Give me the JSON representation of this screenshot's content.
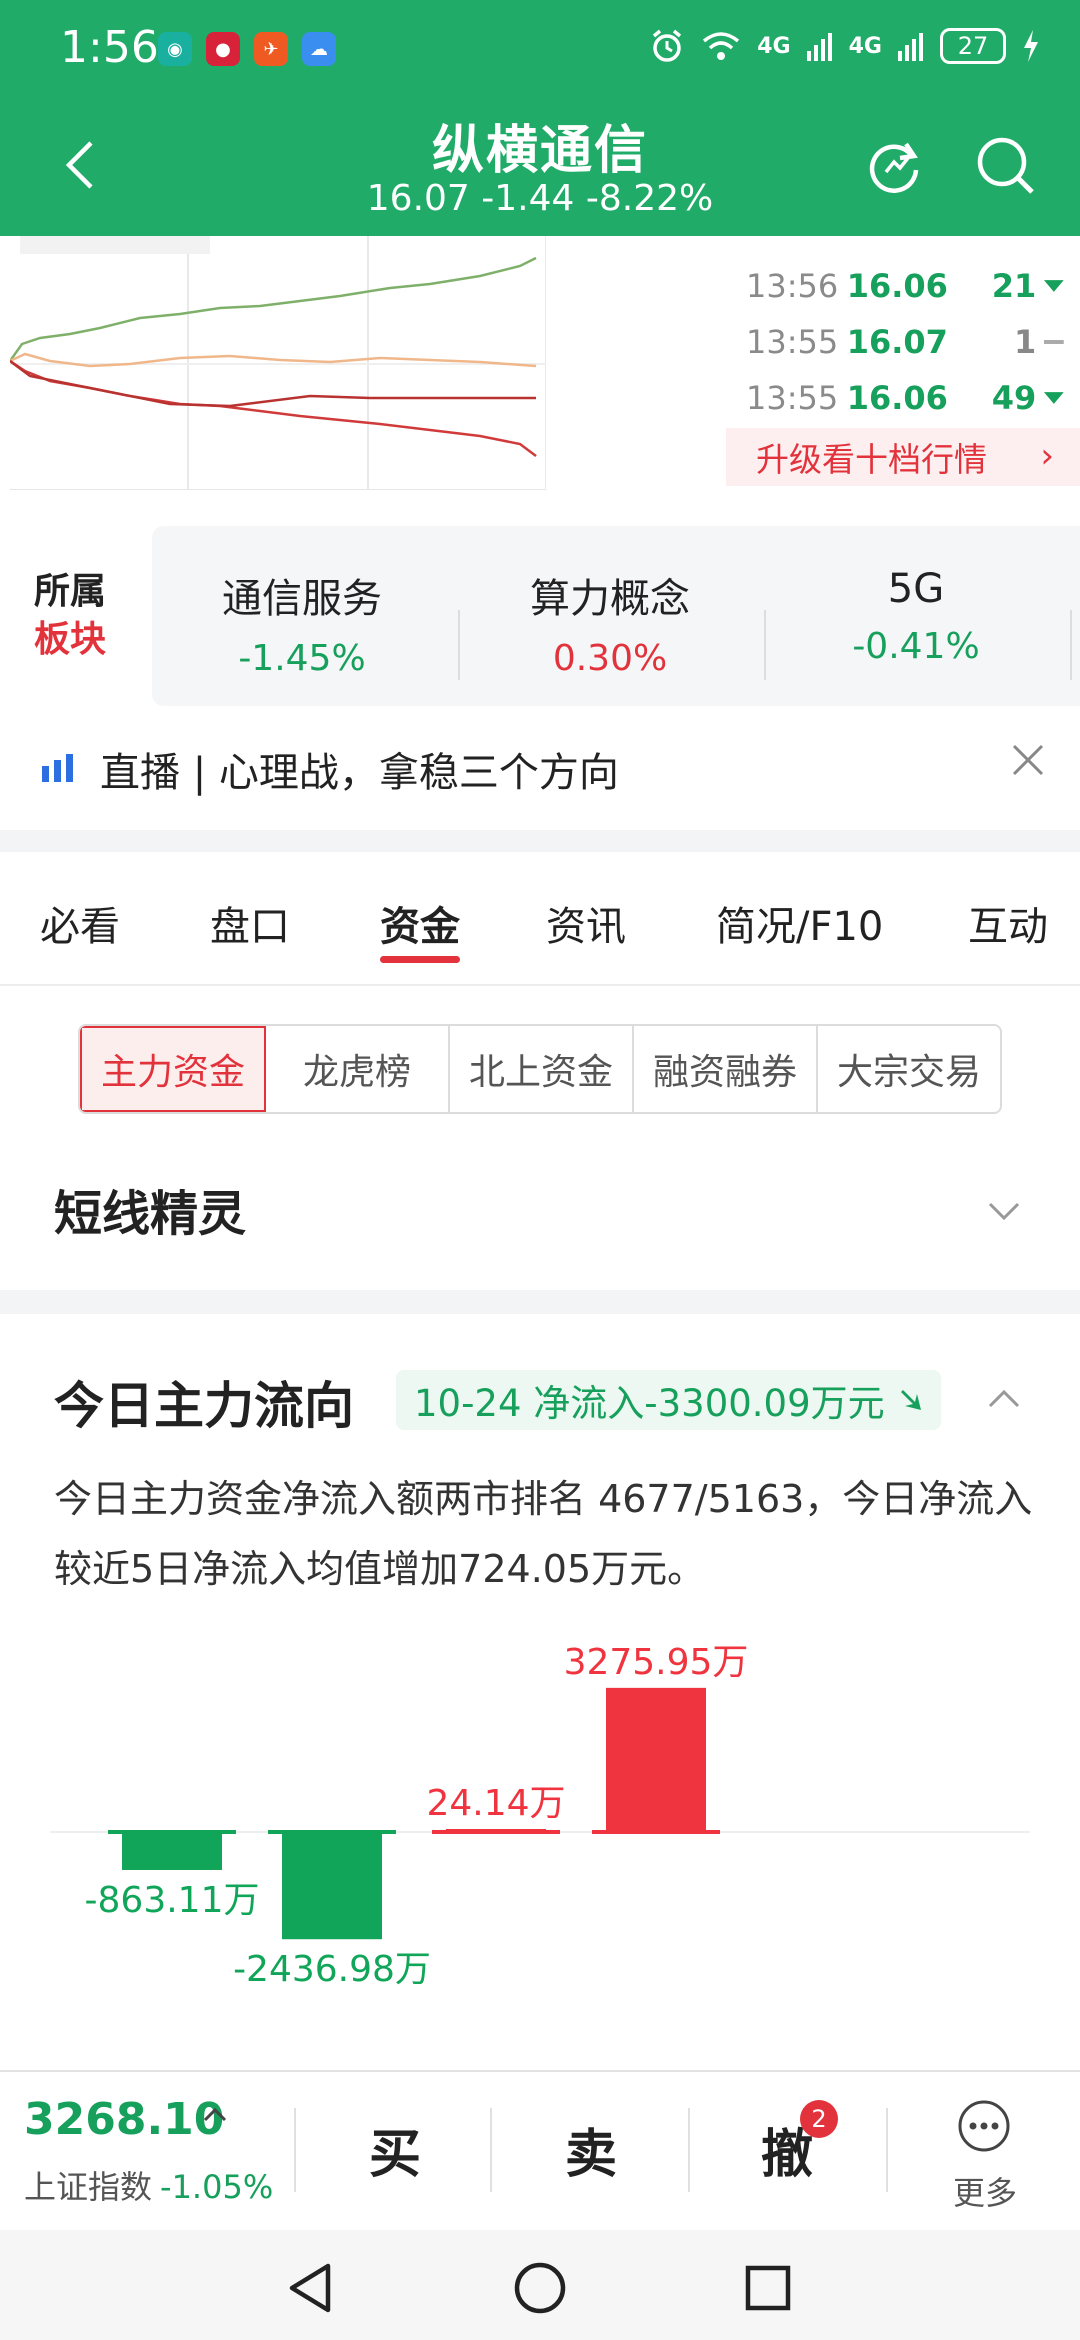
{
  "status_bar": {
    "time": "1:56",
    "battery": "27",
    "net1": "4G",
    "net2": "4G"
  },
  "header": {
    "title": "纵横通信",
    "subtitle": "16.07 -1.44 -8.22%"
  },
  "ticks": [
    {
      "time": "13:56",
      "price": "16.06",
      "vol": "21",
      "dir": "down"
    },
    {
      "time": "13:55",
      "price": "16.07",
      "vol": "1",
      "dir": "flat"
    },
    {
      "time": "13:55",
      "price": "16.06",
      "vol": "49",
      "dir": "down"
    }
  ],
  "upgrade_label": "升级看十档行情",
  "sector": {
    "label_line1": "所属",
    "label_line2": "板块",
    "items": [
      {
        "name": "通信服务",
        "pct": "-1.45%",
        "color": "#16a05c"
      },
      {
        "name": "算力概念",
        "pct": "0.30%",
        "color": "#e2333c"
      },
      {
        "name": "5G",
        "pct": "-0.41%",
        "color": "#16a05c"
      }
    ]
  },
  "live": {
    "text": "直播 | 心理战，拿稳三个方向"
  },
  "tabs": [
    "必看",
    "盘口",
    "资金",
    "资讯",
    "简况/F10",
    "互动"
  ],
  "active_tab": "资金",
  "subtabs": [
    "主力资金",
    "龙虎榜",
    "北上资金",
    "融资融券",
    "大宗交易"
  ],
  "shortline": {
    "title": "短线精灵"
  },
  "flow": {
    "title": "今日主力流向",
    "pill": "10-24 净流入-3300.09万元",
    "desc": "今日主力资金净流入额两市排名 4677/5163，今日净流入较近5日净流入均值增加724.05万元。"
  },
  "chart_data": {
    "type": "bar",
    "categories": [
      "",
      "",
      "",
      ""
    ],
    "values": [
      -863.11,
      -2436.98,
      24.14,
      3275.95
    ],
    "labels": [
      "-863.11万",
      "-2436.98万",
      "24.14万",
      "3275.95万"
    ],
    "title": "",
    "xlabel": "",
    "ylabel": "",
    "ylim": [
      -3000,
      3500
    ],
    "grid": false,
    "colors": {
      "positive": "#f0343f",
      "negative": "#10a558"
    }
  },
  "bottom": {
    "index_value": "3268.10",
    "index_name": "上证指数",
    "index_pct": "-1.05%",
    "buy": "买",
    "sell": "卖",
    "cancel": "撤",
    "cancel_badge": "2",
    "more": "更多"
  },
  "colors": {
    "brand_green": "#21ab69",
    "down_green": "#16a05c",
    "up_red": "#e2333c"
  }
}
